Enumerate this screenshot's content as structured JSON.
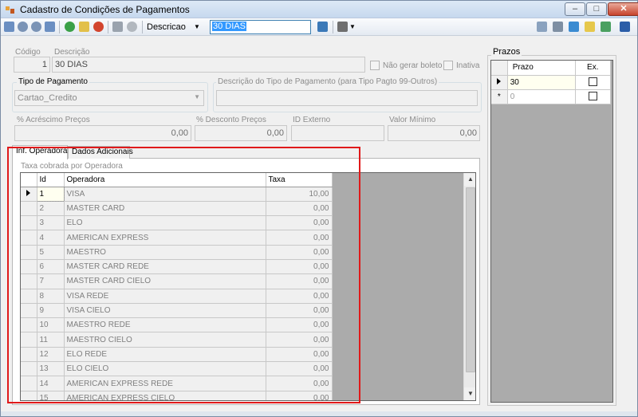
{
  "window": {
    "title": "Cadastro de Condições de Pagamentos",
    "controls": [
      "minimize-icon",
      "maximize-icon",
      "close-icon"
    ]
  },
  "toolbar": {
    "search_field_label": "Descricao",
    "search_value": "30 DIAS"
  },
  "form": {
    "codigo_label": "Código",
    "codigo_value": "1",
    "descricao_label": "Descrição",
    "descricao_value": "30 DIAS",
    "nao_gerar_boleto_label": "Não gerar boleto",
    "inativa_label": "Inativa",
    "tipo_pagamento_group": "Tipo de Pagamento",
    "tipo_pagamento_value": "Cartao_Credito",
    "descricao_tipo_group": "Descrição do Tipo de Pagamento (para Tipo Pagto 99-Outros)",
    "descricao_tipo_value": "",
    "acrescimo_label": "% Acréscimo Preços",
    "acrescimo_value": "0,00",
    "desconto_label": "% Desconto Preços",
    "desconto_value": "0,00",
    "id_externo_label": "ID Externo",
    "id_externo_value": "",
    "valor_minimo_label": "Valor Mínimo",
    "valor_minimo_value": "0,00"
  },
  "tabs": [
    "Inf. Operadora",
    "Dados Adicionais"
  ],
  "active_tab": "Inf. Operadora",
  "operadoras": {
    "caption": "Taxa cobrada por Operadora",
    "columns": [
      "Id",
      "Operadora",
      "Taxa"
    ],
    "rows": [
      {
        "id": "1",
        "operadora": "VISA",
        "taxa": "10,00"
      },
      {
        "id": "2",
        "operadora": "MASTER CARD",
        "taxa": "0,00"
      },
      {
        "id": "3",
        "operadora": "ELO",
        "taxa": "0,00"
      },
      {
        "id": "4",
        "operadora": "AMERICAN EXPRESS",
        "taxa": "0,00"
      },
      {
        "id": "5",
        "operadora": "MAESTRO",
        "taxa": "0,00"
      },
      {
        "id": "6",
        "operadora": "MASTER CARD REDE",
        "taxa": "0,00"
      },
      {
        "id": "7",
        "operadora": "MASTER CARD CIELO",
        "taxa": "0,00"
      },
      {
        "id": "8",
        "operadora": "VISA REDE",
        "taxa": "0,00"
      },
      {
        "id": "9",
        "operadora": "VISA CIELO",
        "taxa": "0,00"
      },
      {
        "id": "10",
        "operadora": "MAESTRO REDE",
        "taxa": "0,00"
      },
      {
        "id": "11",
        "operadora": "MAESTRO CIELO",
        "taxa": "0,00"
      },
      {
        "id": "12",
        "operadora": "ELO REDE",
        "taxa": "0,00"
      },
      {
        "id": "13",
        "operadora": "ELO CIELO",
        "taxa": "0,00"
      },
      {
        "id": "14",
        "operadora": "AMERICAN EXPRESS REDE",
        "taxa": "0,00"
      },
      {
        "id": "15",
        "operadora": "AMERICAN EXPRESS CIELO",
        "taxa": "0,00"
      }
    ]
  },
  "prazos": {
    "title": "Prazos",
    "columns": [
      "Prazo",
      "Ex."
    ],
    "rows": [
      {
        "prazo": "30",
        "ex": false
      },
      {
        "prazo": "0",
        "ex": false
      }
    ]
  },
  "colors": {
    "highlight_border": "#e0191a",
    "selection": "#3399ff",
    "grid_background": "#ababab"
  }
}
